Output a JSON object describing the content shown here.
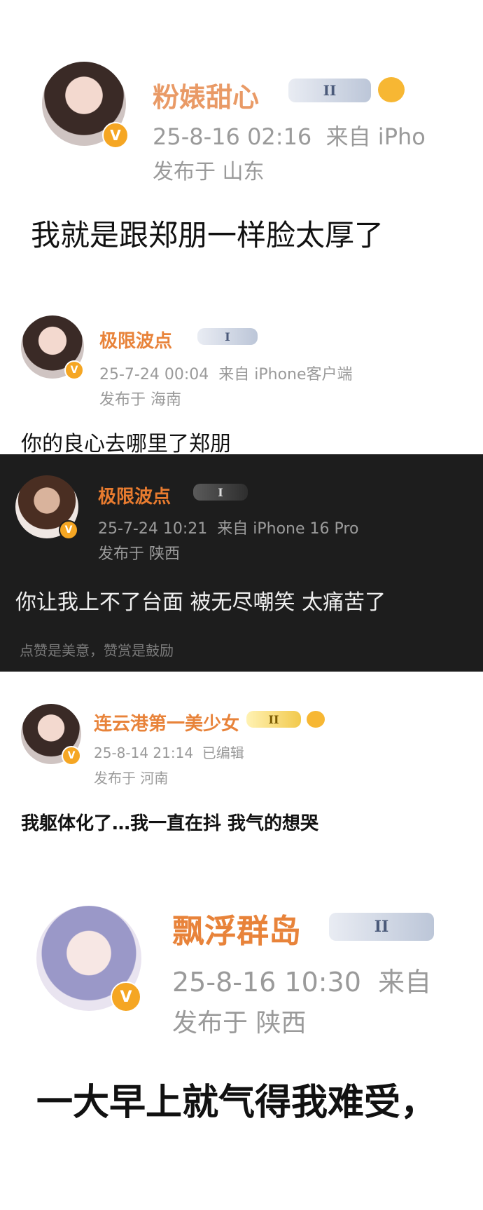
{
  "posts": [
    {
      "username": "粉婊甜心",
      "level": "II",
      "timestamp": "25-8-16 02:16",
      "source": "来自 iPho",
      "location": "发布于 山东",
      "content": "我就是跟郑朋一样脸太厚了"
    },
    {
      "username": "极限波点",
      "level": "I",
      "timestamp": "25-7-24 00:04",
      "source": "来自 iPhone客户端",
      "location": "发布于 海南",
      "content": "你的良心去哪里了郑朋"
    },
    {
      "username": "极限波点",
      "level": "I",
      "timestamp": "25-7-24 10:21",
      "source": "来自 iPhone 16 Pro",
      "location": "发布于 陕西",
      "content": "你让我上不了台面 被无尽嘲笑 太痛苦了",
      "footer": "点赞是美意，赞赏是鼓励"
    },
    {
      "username": "连云港第一美少女",
      "level": "II",
      "timestamp": "25-8-14 21:14",
      "source": "已编辑",
      "location": "发布于 河南",
      "content": "我躯体化了…我一直在抖 我气的想哭"
    },
    {
      "username": "飘浮群岛",
      "level": "II",
      "timestamp": "25-8-16 10:30",
      "source": "来自",
      "location": "发布于 陕西",
      "content": "一大早上就气得我难受，"
    }
  ],
  "badge": {
    "v_label": "V"
  }
}
